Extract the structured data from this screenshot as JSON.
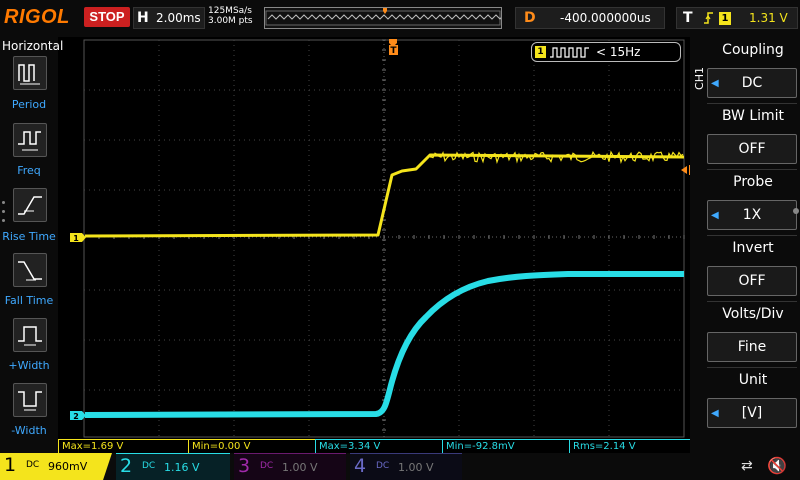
{
  "brand": "RIGOL",
  "run_state": "STOP",
  "timebase": {
    "letter": "H",
    "value": "2.00ms"
  },
  "sampling": {
    "rate": "125MSa/s",
    "points": "3.00M pts"
  },
  "trigger_marker": "T",
  "delay": {
    "letter": "D",
    "value": "-400.000000us"
  },
  "trigger": {
    "letter": "T",
    "edge": "rising-edge-icon",
    "source": "1",
    "level": "1.31 V"
  },
  "left_panel": {
    "title": "Horizontal",
    "items": [
      {
        "label": "Period",
        "icon": "period-icon"
      },
      {
        "label": "Freq",
        "icon": "frequency-icon"
      },
      {
        "label": "Rise Time",
        "icon": "rise-time-icon"
      },
      {
        "label": "Fall Time",
        "icon": "fall-time-icon"
      },
      {
        "label": "+Width",
        "icon": "positive-width-icon"
      },
      {
        "label": "-Width",
        "icon": "negative-width-icon"
      }
    ]
  },
  "frequency_counter": {
    "channel": "1",
    "value": "< 15Hz"
  },
  "channel_markers": {
    "ch1": "1",
    "ch2": "2"
  },
  "right_panel": {
    "channel_label": "CH1",
    "menus": [
      {
        "title": "Coupling",
        "value": "DC"
      },
      {
        "title": "BW Limit",
        "value": "OFF"
      },
      {
        "title": "Probe",
        "value": "1X"
      },
      {
        "title": "Invert",
        "value": "OFF"
      },
      {
        "title": "Volts/Div",
        "value": "Fine"
      },
      {
        "title": "Unit",
        "value": "[V]"
      }
    ]
  },
  "measurements": [
    {
      "text": "Max=1.69 V",
      "color": "#f4e41c"
    },
    {
      "text": "Min=0.00 V",
      "color": "#f4e41c"
    },
    {
      "text": "Max=3.34 V",
      "color": "#28dde6"
    },
    {
      "text": "Min=-92.8mV",
      "color": "#28dde6"
    },
    {
      "text": "Rms=2.14 V",
      "color": "#28dde6"
    }
  ],
  "channels": [
    {
      "num": "1",
      "coupling": "DC",
      "scale": "960mV",
      "color": "#f4e41c"
    },
    {
      "num": "2",
      "coupling": "DC",
      "scale": "1.16 V",
      "color": "#28dde6"
    },
    {
      "num": "3",
      "coupling": "DC",
      "scale": "1.00 V",
      "color": "#a02aaa"
    },
    {
      "num": "4",
      "coupling": "DC",
      "scale": "1.00 V",
      "color": "#6a6ac6"
    }
  ],
  "status": {
    "usb": "usb-icon",
    "sound": "speaker-muted-icon"
  }
}
